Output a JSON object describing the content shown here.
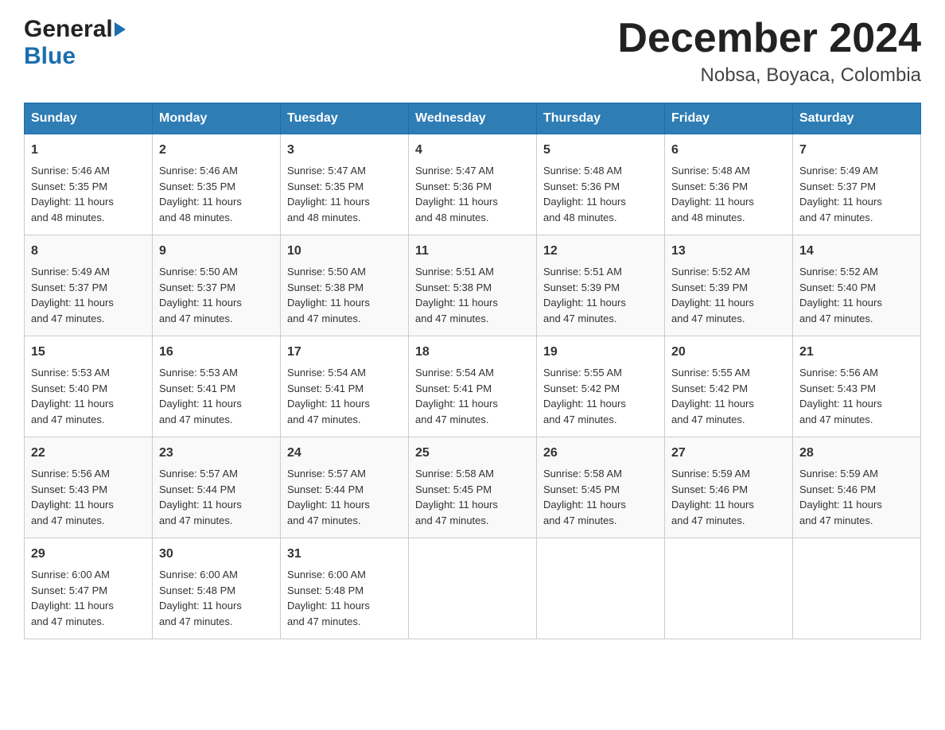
{
  "header": {
    "logo_general": "General",
    "logo_blue": "Blue",
    "month_title": "December 2024",
    "subtitle": "Nobsa, Boyaca, Colombia"
  },
  "days_of_week": [
    "Sunday",
    "Monday",
    "Tuesday",
    "Wednesday",
    "Thursday",
    "Friday",
    "Saturday"
  ],
  "weeks": [
    [
      {
        "day": "1",
        "sunrise": "5:46 AM",
        "sunset": "5:35 PM",
        "daylight": "11 hours and 48 minutes."
      },
      {
        "day": "2",
        "sunrise": "5:46 AM",
        "sunset": "5:35 PM",
        "daylight": "11 hours and 48 minutes."
      },
      {
        "day": "3",
        "sunrise": "5:47 AM",
        "sunset": "5:35 PM",
        "daylight": "11 hours and 48 minutes."
      },
      {
        "day": "4",
        "sunrise": "5:47 AM",
        "sunset": "5:36 PM",
        "daylight": "11 hours and 48 minutes."
      },
      {
        "day": "5",
        "sunrise": "5:48 AM",
        "sunset": "5:36 PM",
        "daylight": "11 hours and 48 minutes."
      },
      {
        "day": "6",
        "sunrise": "5:48 AM",
        "sunset": "5:36 PM",
        "daylight": "11 hours and 48 minutes."
      },
      {
        "day": "7",
        "sunrise": "5:49 AM",
        "sunset": "5:37 PM",
        "daylight": "11 hours and 47 minutes."
      }
    ],
    [
      {
        "day": "8",
        "sunrise": "5:49 AM",
        "sunset": "5:37 PM",
        "daylight": "11 hours and 47 minutes."
      },
      {
        "day": "9",
        "sunrise": "5:50 AM",
        "sunset": "5:37 PM",
        "daylight": "11 hours and 47 minutes."
      },
      {
        "day": "10",
        "sunrise": "5:50 AM",
        "sunset": "5:38 PM",
        "daylight": "11 hours and 47 minutes."
      },
      {
        "day": "11",
        "sunrise": "5:51 AM",
        "sunset": "5:38 PM",
        "daylight": "11 hours and 47 minutes."
      },
      {
        "day": "12",
        "sunrise": "5:51 AM",
        "sunset": "5:39 PM",
        "daylight": "11 hours and 47 minutes."
      },
      {
        "day": "13",
        "sunrise": "5:52 AM",
        "sunset": "5:39 PM",
        "daylight": "11 hours and 47 minutes."
      },
      {
        "day": "14",
        "sunrise": "5:52 AM",
        "sunset": "5:40 PM",
        "daylight": "11 hours and 47 minutes."
      }
    ],
    [
      {
        "day": "15",
        "sunrise": "5:53 AM",
        "sunset": "5:40 PM",
        "daylight": "11 hours and 47 minutes."
      },
      {
        "day": "16",
        "sunrise": "5:53 AM",
        "sunset": "5:41 PM",
        "daylight": "11 hours and 47 minutes."
      },
      {
        "day": "17",
        "sunrise": "5:54 AM",
        "sunset": "5:41 PM",
        "daylight": "11 hours and 47 minutes."
      },
      {
        "day": "18",
        "sunrise": "5:54 AM",
        "sunset": "5:41 PM",
        "daylight": "11 hours and 47 minutes."
      },
      {
        "day": "19",
        "sunrise": "5:55 AM",
        "sunset": "5:42 PM",
        "daylight": "11 hours and 47 minutes."
      },
      {
        "day": "20",
        "sunrise": "5:55 AM",
        "sunset": "5:42 PM",
        "daylight": "11 hours and 47 minutes."
      },
      {
        "day": "21",
        "sunrise": "5:56 AM",
        "sunset": "5:43 PM",
        "daylight": "11 hours and 47 minutes."
      }
    ],
    [
      {
        "day": "22",
        "sunrise": "5:56 AM",
        "sunset": "5:43 PM",
        "daylight": "11 hours and 47 minutes."
      },
      {
        "day": "23",
        "sunrise": "5:57 AM",
        "sunset": "5:44 PM",
        "daylight": "11 hours and 47 minutes."
      },
      {
        "day": "24",
        "sunrise": "5:57 AM",
        "sunset": "5:44 PM",
        "daylight": "11 hours and 47 minutes."
      },
      {
        "day": "25",
        "sunrise": "5:58 AM",
        "sunset": "5:45 PM",
        "daylight": "11 hours and 47 minutes."
      },
      {
        "day": "26",
        "sunrise": "5:58 AM",
        "sunset": "5:45 PM",
        "daylight": "11 hours and 47 minutes."
      },
      {
        "day": "27",
        "sunrise": "5:59 AM",
        "sunset": "5:46 PM",
        "daylight": "11 hours and 47 minutes."
      },
      {
        "day": "28",
        "sunrise": "5:59 AM",
        "sunset": "5:46 PM",
        "daylight": "11 hours and 47 minutes."
      }
    ],
    [
      {
        "day": "29",
        "sunrise": "6:00 AM",
        "sunset": "5:47 PM",
        "daylight": "11 hours and 47 minutes."
      },
      {
        "day": "30",
        "sunrise": "6:00 AM",
        "sunset": "5:48 PM",
        "daylight": "11 hours and 47 minutes."
      },
      {
        "day": "31",
        "sunrise": "6:00 AM",
        "sunset": "5:48 PM",
        "daylight": "11 hours and 47 minutes."
      },
      null,
      null,
      null,
      null
    ]
  ],
  "labels": {
    "sunrise": "Sunrise:",
    "sunset": "Sunset:",
    "daylight": "Daylight:"
  }
}
